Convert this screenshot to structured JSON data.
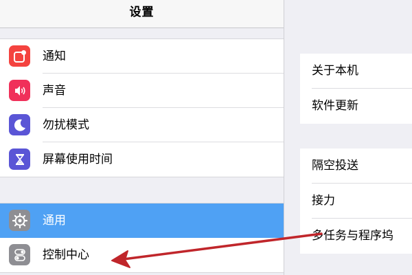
{
  "header": {
    "title": "设置"
  },
  "sidebar": {
    "group1": [
      {
        "label": "通知",
        "icon": "notifications-icon",
        "color": "#f4433f"
      },
      {
        "label": "声音",
        "icon": "sound-icon",
        "color": "#f0305a"
      },
      {
        "label": "勿扰模式",
        "icon": "moon-icon",
        "color": "#5a55d6"
      },
      {
        "label": "屏幕使用时间",
        "icon": "hourglass-icon",
        "color": "#5a55d6"
      }
    ],
    "group2": [
      {
        "label": "通用",
        "icon": "gear-icon",
        "color": "#8e8e93",
        "selected": true
      },
      {
        "label": "控制中心",
        "icon": "control-center-icon",
        "color": "#8e8e93"
      }
    ]
  },
  "detail": {
    "group1": [
      "关于本机",
      "软件更新"
    ],
    "group2": [
      "隔空投送",
      "接力",
      "多任务与程序坞"
    ]
  },
  "colors": {
    "selected": "#4fa1f4",
    "annotation_arrow": "#c0262b"
  }
}
